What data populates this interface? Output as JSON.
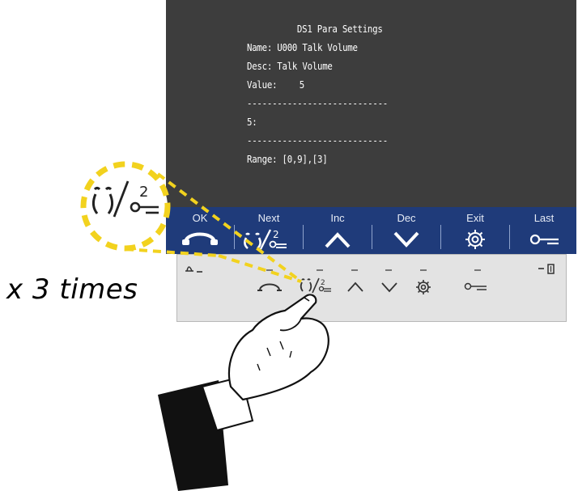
{
  "screen": {
    "title": "DS1 Para Settings",
    "name_line": "Name: U000 Talk Volume",
    "desc_line": "Desc: Talk Volume",
    "value_label": "Value:",
    "value": "5",
    "divider": "----------------------------",
    "entry_line": "5:",
    "range_line": "Range: [0,9],[3]"
  },
  "softkeys": [
    {
      "label": "OK",
      "icon": "handset-icon"
    },
    {
      "label": "Next",
      "icon": "next-key-icon"
    },
    {
      "label": "Inc",
      "icon": "chevron-up-icon"
    },
    {
      "label": "Dec",
      "icon": "chevron-down-icon"
    },
    {
      "label": "Exit",
      "icon": "gear-icon"
    },
    {
      "label": "Last",
      "icon": "key-icon"
    }
  ],
  "callout": {
    "number": "2",
    "instruction": "x 3 times"
  },
  "colors": {
    "screen_bg": "#3d3d3d",
    "keybar_bg": "#1f3b7a",
    "panel_bg": "#e3e3e3",
    "highlight": "#f2d21e"
  }
}
